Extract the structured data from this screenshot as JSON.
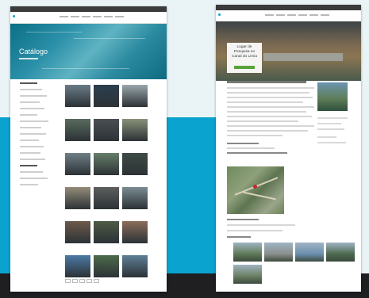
{
  "colors": {
    "accent": "#0aa3cf",
    "background": "#eaf4f7",
    "page": "#ffffff",
    "topbar": "#3b3b3b"
  },
  "left_page": {
    "logo_text": "",
    "hero_title": "Catálogo",
    "thumbnails": [
      {
        "color": "#6a7b86"
      },
      {
        "color": "#2b3f4f"
      },
      {
        "color": "#9aa7ac"
      },
      {
        "color": "#596b5e"
      },
      {
        "color": "#4a4f53"
      },
      {
        "color": "#879178"
      },
      {
        "color": "#6f7f86"
      },
      {
        "color": "#667e6a"
      },
      {
        "color": "#3e4b45"
      },
      {
        "color": "#948c79"
      },
      {
        "color": "#5c5f5d"
      },
      {
        "color": "#7a8c92"
      },
      {
        "color": "#6d5a4a"
      },
      {
        "color": "#4e5b46"
      },
      {
        "color": "#8a6d5a"
      },
      {
        "color": "#4b7aa6"
      },
      {
        "color": "#4c6a4b"
      },
      {
        "color": "#5e7f96"
      }
    ]
  },
  "right_page": {
    "logo_text": "",
    "hero_title": "Lugar de Pesquisa en Canal do Limia",
    "photos": [
      {
        "color": "#5e7a56"
      },
      {
        "color": "#8a8f8c"
      },
      {
        "color": "#6c8fb0"
      },
      {
        "color": "#4d6a4f"
      },
      {
        "color": "#6a7e62"
      }
    ]
  }
}
